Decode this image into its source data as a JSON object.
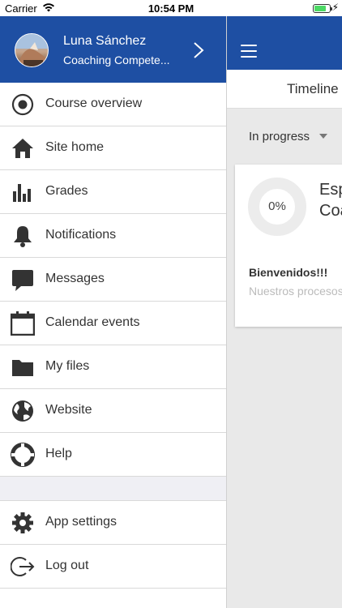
{
  "status_bar": {
    "carrier": "Carrier",
    "time": "10:54 PM",
    "battery_level": 0.75
  },
  "colors": {
    "header_blue": "#1e4fa3",
    "icon_gray": "#333333",
    "battery_green": "#4cd964"
  },
  "drawer": {
    "user": {
      "name": "Luna Sánchez",
      "site": "Coaching Compete..."
    },
    "items": [
      {
        "label": "Course overview",
        "icon": "course-overview-icon"
      },
      {
        "label": "Site home",
        "icon": "home-icon"
      },
      {
        "label": "Grades",
        "icon": "grades-icon"
      },
      {
        "label": "Notifications",
        "icon": "bell-icon"
      },
      {
        "label": "Messages",
        "icon": "chat-icon"
      },
      {
        "label": "Calendar events",
        "icon": "calendar-icon"
      },
      {
        "label": "My files",
        "icon": "folder-icon"
      },
      {
        "label": "Website",
        "icon": "globe-icon"
      },
      {
        "label": "Help",
        "icon": "lifebuoy-icon"
      }
    ],
    "bottom_items": [
      {
        "label": "App settings",
        "icon": "gear-icon"
      },
      {
        "label": "Log out",
        "icon": "logout-icon"
      }
    ]
  },
  "main": {
    "tab": "Timeline",
    "filter": "In progress",
    "course": {
      "progress_label": "0%",
      "progress": 0,
      "title_line1": "Esp",
      "title_line2": "Coa",
      "summary_heading": "Bienvenidos!!!",
      "summary_text": "Nuestros procesos"
    }
  }
}
